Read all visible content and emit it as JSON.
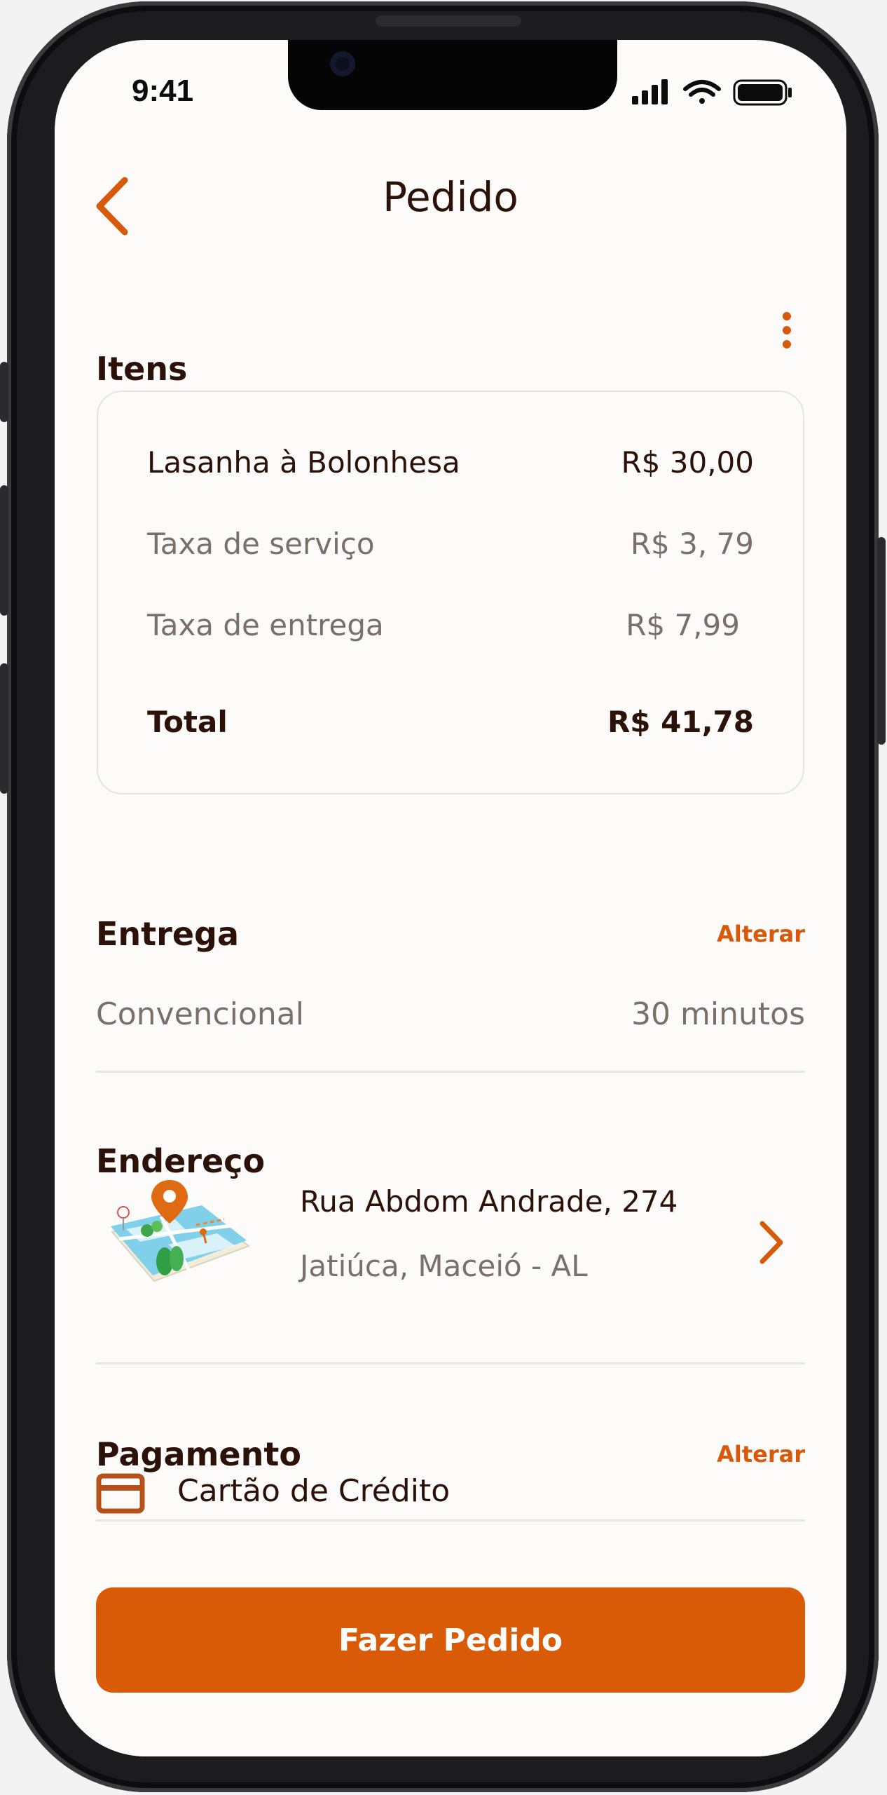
{
  "status_bar": {
    "time": "9:41"
  },
  "header": {
    "title": "Pedido"
  },
  "items_section": {
    "title": "Itens",
    "rows": [
      {
        "label": "Lasanha  à Bolonhesa",
        "value": "R$ 30,00"
      },
      {
        "label": "Taxa de serviço",
        "value": "R$ 3, 79"
      },
      {
        "label": "Taxa de entrega",
        "value": "R$ 7,99"
      }
    ],
    "total": {
      "label": "Total",
      "value": "R$ 41,78"
    }
  },
  "delivery": {
    "title": "Entrega",
    "change_label": "Alterar",
    "method": "Convencional",
    "time": "30 minutos"
  },
  "address": {
    "title": "Endereço",
    "line1": "Rua Abdom Andrade, 274",
    "line2": "Jatiúca, Maceió - AL"
  },
  "payment": {
    "title": "Pagamento",
    "change_label": "Alterar",
    "method": "Cartão de Crédito"
  },
  "cta": {
    "label": "Fazer Pedido"
  },
  "colors": {
    "accent": "#d95a07",
    "text_dark": "#2c1108",
    "text_muted": "#7a6f6a",
    "background": "#fcfbf9"
  },
  "icons": [
    "back-chevron-icon",
    "more-vertical-icon",
    "map-pin-icon",
    "chevron-right-icon",
    "credit-card-icon",
    "signal-icon",
    "wifi-icon",
    "battery-icon"
  ]
}
